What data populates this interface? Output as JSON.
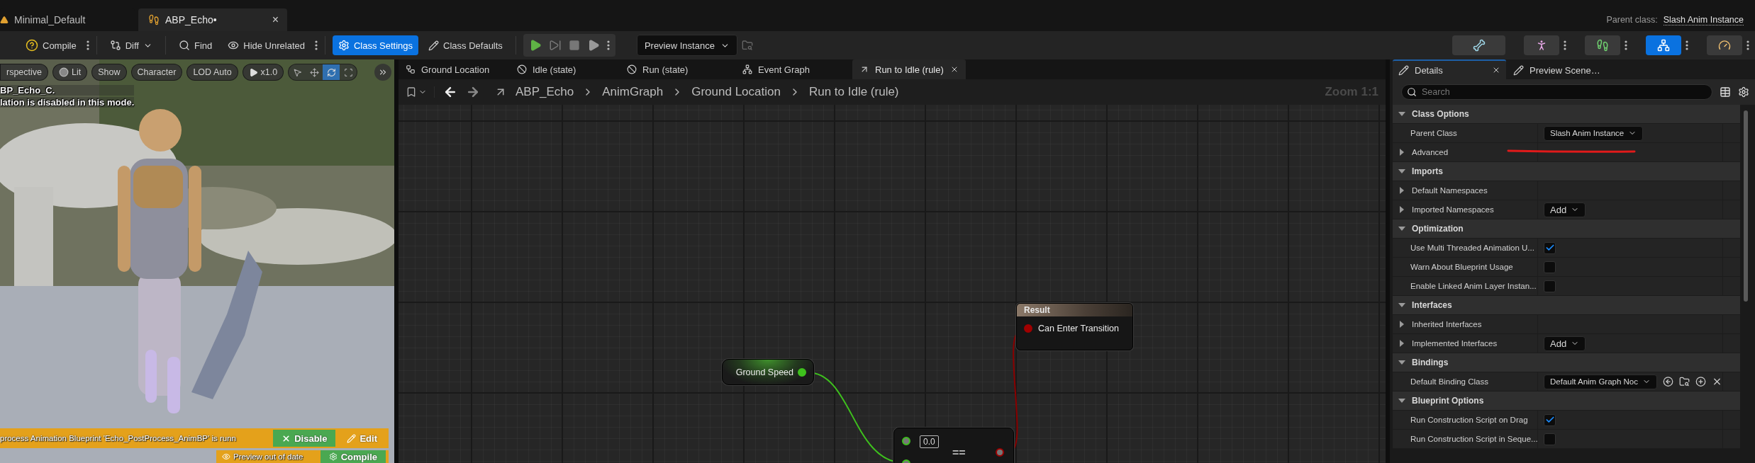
{
  "document_tabs": [
    {
      "label": "Minimal_Default",
      "kind": "level",
      "selected": false
    },
    {
      "label": "ABP_Echo•",
      "kind": "anim_blueprint",
      "selected": true,
      "close": "×"
    }
  ],
  "parent_class": {
    "label": "Parent class:",
    "value": "Slash Anim Instance"
  },
  "toolbar": {
    "compile": "Compile",
    "diff": "Diff",
    "find": "Find",
    "hide_unrelated": "Hide Unrelated",
    "class_settings": {
      "label": "Class Settings",
      "selected": true
    },
    "class_defaults": {
      "label": "Class Defaults",
      "selected": false
    },
    "preview_instance": "Preview Instance"
  },
  "mode_buttons": [
    {
      "kind": "skeleton",
      "selected": false
    },
    {
      "kind": "mesh",
      "selected": false
    },
    {
      "kind": "animation",
      "selected": false
    },
    {
      "kind": "blueprint",
      "selected": true
    },
    {
      "kind": "physics",
      "selected": false
    }
  ],
  "viewport": {
    "toolbar": [
      {
        "label": "rspective",
        "kind": "text"
      },
      {
        "label": "Lit",
        "kind": "lit"
      },
      {
        "label": "Show",
        "kind": "text"
      },
      {
        "label": "Character",
        "kind": "text"
      },
      {
        "label": "LOD Auto",
        "kind": "text"
      },
      {
        "label": "x1.0",
        "kind": "play"
      }
    ],
    "transform_tools": [
      {
        "kind": "select",
        "selected": false
      },
      {
        "kind": "move",
        "selected": false
      },
      {
        "kind": "rotate",
        "selected": true
      },
      {
        "kind": "scale",
        "selected": false
      }
    ],
    "overlay_lines": [
      "BP_Echo_C.",
      "lation is disabled in this mode."
    ],
    "notices": [
      {
        "message": "process Animation Blueprint 'Echo_PostProcess_AnimBP' is runn",
        "buttons": [
          {
            "label": "Disable",
            "kind": "primary"
          },
          {
            "label": "Edit",
            "kind": "plain"
          }
        ]
      },
      {
        "message": "Preview out of date",
        "buttons": [
          {
            "label": "Compile",
            "kind": "primary"
          }
        ]
      }
    ]
  },
  "graph": {
    "tabs": [
      {
        "label": "Ground Location",
        "kind": "state_machine",
        "selected": false
      },
      {
        "label": "Idle (state)",
        "kind": "state",
        "selected": false
      },
      {
        "label": "Run (state)",
        "kind": "state",
        "selected": false
      },
      {
        "label": "Event Graph",
        "kind": "event_graph",
        "selected": false
      },
      {
        "label": "Run to Idle (rule)",
        "kind": "rule",
        "selected": true
      }
    ],
    "breadcrumb": [
      "ABP_Echo",
      "AnimGraph",
      "Ground Location",
      "Run to Idle (rule)"
    ],
    "zoom": "Zoom 1:1",
    "nodes": [
      {
        "kind": "result",
        "title": "Result",
        "pin": "Can Enter Transition"
      },
      {
        "kind": "variable",
        "title": "Ground Speed"
      },
      {
        "kind": "compare",
        "operator": "==",
        "default_value": "0.0"
      }
    ]
  },
  "details": {
    "tabs": [
      {
        "label": "Details",
        "selected": true
      },
      {
        "label": "Preview Scene…",
        "selected": false
      }
    ],
    "search": {
      "placeholder": "Search"
    },
    "sections": [
      {
        "title": "Class Options",
        "expanded": true,
        "rows": [
          {
            "label": "Parent Class",
            "control": {
              "kind": "dropdown",
              "value": "Slash Anim Instance"
            }
          },
          {
            "label": "Advanced",
            "expanded": false,
            "annotated": true
          }
        ]
      },
      {
        "title": "Imports",
        "expanded": true,
        "rows": [
          {
            "label": "Default Namespaces",
            "expanded": false
          },
          {
            "label": "Imported Namespaces",
            "expanded": false,
            "control": {
              "kind": "add",
              "value": "Add"
            }
          }
        ]
      },
      {
        "title": "Optimization",
        "expanded": true,
        "rows": [
          {
            "label": "Use Multi Threaded Animation U...",
            "control": {
              "kind": "checkbox",
              "checked": true
            }
          },
          {
            "label": "Warn About Blueprint Usage",
            "control": {
              "kind": "checkbox",
              "checked": false
            }
          },
          {
            "label": "Enable Linked Anim Layer Instan...",
            "control": {
              "kind": "checkbox",
              "checked": false
            }
          }
        ]
      },
      {
        "title": "Interfaces",
        "expanded": true,
        "rows": [
          {
            "label": "Inherited Interfaces",
            "expanded": false
          },
          {
            "label": "Implemented Interfaces",
            "expanded": false,
            "control": {
              "kind": "add",
              "value": "Add"
            }
          }
        ]
      },
      {
        "title": "Bindings",
        "expanded": true,
        "rows": [
          {
            "label": "Default Binding Class",
            "control": {
              "kind": "class_picker",
              "value": "Default Anim Graph Noc"
            }
          }
        ]
      },
      {
        "title": "Blueprint Options",
        "expanded": true,
        "rows": [
          {
            "label": "Run Construction Script on Drag",
            "control": {
              "kind": "checkbox",
              "checked": true
            }
          },
          {
            "label": "Run Construction Script in Seque...",
            "control": {
              "kind": "checkbox",
              "checked": false
            }
          }
        ]
      }
    ]
  }
}
